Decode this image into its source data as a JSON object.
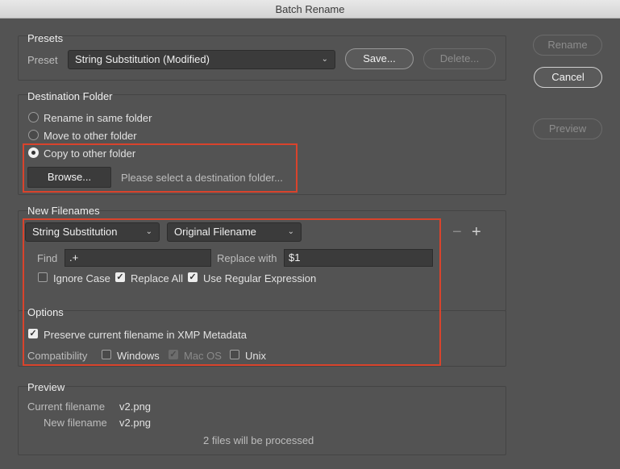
{
  "window": {
    "title": "Batch Rename"
  },
  "presets": {
    "group_title": "Presets",
    "label": "Preset",
    "selected": "String Substitution (Modified)",
    "save": "Save...",
    "delete": "Delete..."
  },
  "actions": {
    "rename": "Rename",
    "cancel": "Cancel",
    "preview": "Preview"
  },
  "destination": {
    "group_title": "Destination Folder",
    "options": [
      "Rename in same folder",
      "Move to other folder",
      "Copy to other folder"
    ],
    "selected_index": 2,
    "browse": "Browse...",
    "folder_placeholder": "Please select a destination folder..."
  },
  "new_filenames": {
    "group_title": "New Filenames",
    "type_select": "String Substitution",
    "source_select": "Original Filename",
    "find_label": "Find",
    "find_value": ".+",
    "replace_label": "Replace with",
    "replace_value": "$1",
    "ignore_case": "Ignore Case",
    "ignore_case_checked": false,
    "replace_all": "Replace All",
    "replace_all_checked": true,
    "regex": "Use Regular Expression",
    "regex_checked": true,
    "minus_icon": "minus-icon",
    "plus_icon": "plus-icon"
  },
  "options": {
    "group_title": "Options",
    "preserve": "Preserve current filename in XMP Metadata",
    "preserve_checked": true,
    "compat_label": "Compatibility",
    "windows": "Windows",
    "windows_checked": false,
    "macos": "Mac OS",
    "macos_checked": true,
    "unix": "Unix",
    "unix_checked": false
  },
  "preview": {
    "group_title": "Preview",
    "current_label": "Current filename",
    "current_value": "v2.png",
    "new_label": "New filename",
    "new_value": "v2.png",
    "summary": "2 files will be processed"
  },
  "colors": {
    "highlight": "#d9432c",
    "background": "#535353",
    "field": "#3b3b3b"
  }
}
